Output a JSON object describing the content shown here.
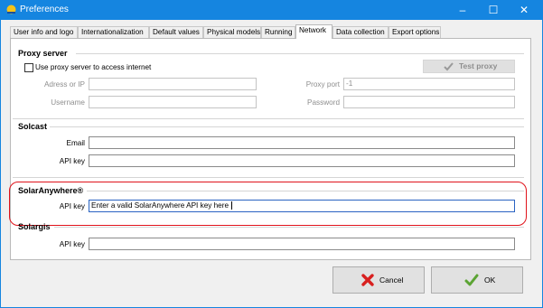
{
  "window": {
    "title": "Preferences",
    "controls": {
      "minimize": "–",
      "maximize": "☐",
      "close": "✕"
    }
  },
  "tabs": [
    {
      "label": "User info and logo",
      "active": false
    },
    {
      "label": "Internationalization",
      "active": false
    },
    {
      "label": "Default values",
      "active": false
    },
    {
      "label": "Physical models",
      "active": false
    },
    {
      "label": "Running",
      "active": false
    },
    {
      "label": "Network",
      "active": true
    },
    {
      "label": "Data collection",
      "active": false
    },
    {
      "label": "Export options",
      "active": false
    }
  ],
  "proxy": {
    "title": "Proxy server",
    "use_proxy_label": "Use proxy server to access internet",
    "use_proxy_checked": false,
    "test_button": "Test proxy",
    "address_label": "Adress or IP",
    "address_value": "",
    "port_label": "Proxy port",
    "port_value": "-1",
    "username_label": "Username",
    "username_value": "",
    "password_label": "Password",
    "password_value": ""
  },
  "solcast": {
    "title": "Solcast",
    "email_label": "Email",
    "email_value": "",
    "apikey_label": "API key",
    "apikey_value": ""
  },
  "solaranywhere": {
    "title": "SolarAnywhere®",
    "apikey_label": "API key",
    "apikey_value": "Enter a valid SolarAnywhere API key here "
  },
  "solargis": {
    "title": "Solargis",
    "apikey_label": "API key",
    "apikey_value": ""
  },
  "buttons": {
    "cancel": "Cancel",
    "ok": "OK"
  },
  "colors": {
    "titlebar": "#1585e0",
    "highlight": "#e0121a",
    "cancel_icon": "#d8201f",
    "ok_icon": "#5ba433"
  }
}
